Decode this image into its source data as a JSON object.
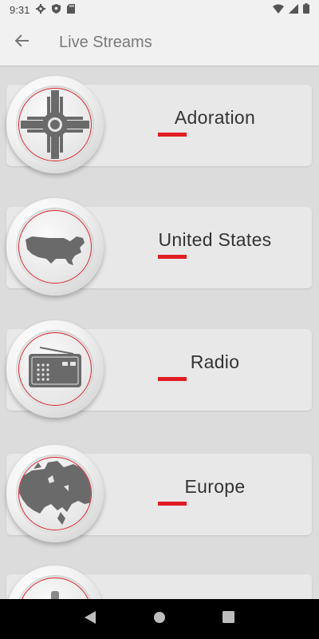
{
  "status_bar": {
    "time": "9:31",
    "icons": [
      "gear-icon",
      "shield-icon",
      "sd-card-icon",
      "wifi-icon",
      "signal-icon",
      "battery-icon"
    ]
  },
  "app_bar": {
    "back_icon": "arrow-back-icon",
    "title": "Live Streams"
  },
  "streams": [
    {
      "label": "Adoration",
      "icon": "monstrance-icon"
    },
    {
      "label": "United States",
      "icon": "usa-map-icon"
    },
    {
      "label": "Radio",
      "icon": "radio-icon"
    },
    {
      "label": "Europe",
      "icon": "europe-map-icon"
    },
    {
      "label": "",
      "icon": "microphone-icon"
    }
  ],
  "colors": {
    "accent": "#e21c23",
    "background": "#dcdcdc",
    "card": "#e8e8e8",
    "bar": "#f1f1f1",
    "nav": "#000000"
  },
  "nav_bar": {
    "buttons": [
      "back-triangle-icon",
      "home-circle-icon",
      "recents-square-icon"
    ]
  }
}
